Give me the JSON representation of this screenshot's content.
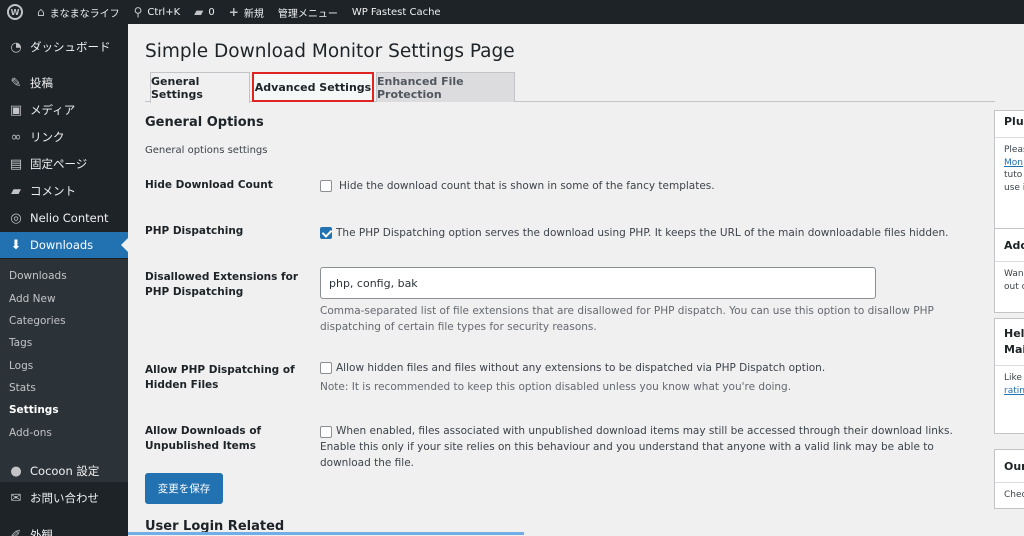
{
  "adminbar": {
    "site_name": "まなまなライフ",
    "search_shortcut": "Ctrl+K",
    "comments_count": "0",
    "new_label": "新規",
    "admin_menu_label": "管理メニュー",
    "cache_label": "WP Fastest Cache"
  },
  "sidebar": {
    "menu": [
      {
        "label": "ダッシュボード",
        "icon": "dashboard-icon"
      },
      {
        "label": "投稿",
        "icon": "pin-icon"
      },
      {
        "label": "メディア",
        "icon": "media-icon"
      },
      {
        "label": "リンク",
        "icon": "link-icon"
      },
      {
        "label": "固定ページ",
        "icon": "page-icon"
      },
      {
        "label": "コメント",
        "icon": "comment-icon"
      },
      {
        "label": "Nelio Content",
        "icon": "nelio-icon"
      },
      {
        "label": "Downloads",
        "icon": "download-icon"
      },
      {
        "label": "Cocoon 設定",
        "icon": "cocoon-icon"
      },
      {
        "label": "お問い合わせ",
        "icon": "mail-icon"
      },
      {
        "label": "外観",
        "icon": "appearance-icon"
      }
    ],
    "submenu": [
      "Downloads",
      "Add New",
      "Categories",
      "Tags",
      "Logs",
      "Stats",
      "Settings",
      "Add-ons"
    ]
  },
  "page": {
    "title": "Simple Download Monitor Settings Page",
    "tabs": [
      "General Settings",
      "Advanced Settings",
      "Enhanced File Protection"
    ],
    "section_title": "General Options",
    "section_desc": "General options settings",
    "rows": {
      "hide_count": {
        "label": "Hide Download Count",
        "text": "Hide the download count that is shown in some of the fancy templates.",
        "checked": false
      },
      "php_dispatch": {
        "label": "PHP Dispatching",
        "text": "The PHP Dispatching option serves the download using PHP. It keeps the URL of the main downloadable files hidden.",
        "checked": true
      },
      "disallowed_ext": {
        "label": "Disallowed Extensions for PHP Dispatching",
        "value": "php, config, bak",
        "desc": "Comma-separated list of file extensions that are disallowed for PHP dispatch. You can use this option to disallow PHP dispatching of certain file types for security reasons."
      },
      "allow_hidden": {
        "label": "Allow PHP Dispatching of Hidden Files",
        "text": "Allow hidden files and files without any extensions to be dispatched via PHP Dispatch option.",
        "note": "Note: It is recommended to keep this option disabled unless you know what you're doing.",
        "checked": false
      },
      "allow_unpublished": {
        "label": "Allow Downloads of Unpublished Items",
        "text": "When enabled, files associated with unpublished download items may still be accessed through their download links. Enable this only if your site relies on this behaviour and you understand that anyone with a valid link may be able to download the file.",
        "checked": false
      }
    },
    "save_label": "変更を保存",
    "next_section": "User Login Related"
  },
  "widgets": [
    {
      "title": "Plug",
      "lines": [
        "Pleas",
        "Mon",
        "tuto",
        "use i"
      ],
      "link_line": 1
    },
    {
      "title": "Add",
      "lines": [
        "Wan",
        "out c"
      ]
    },
    {
      "title": "Help",
      "title2": "Mai",
      "lines": [
        "Like",
        "ratin"
      ],
      "link_line": 1
    },
    {
      "title": "Our",
      "lines": [
        "Chec"
      ]
    }
  ],
  "colors": {
    "admin_dark": "#1d2327",
    "accent_blue": "#2271b1",
    "highlight_red": "#e02424",
    "background": "#f0f0f1"
  }
}
